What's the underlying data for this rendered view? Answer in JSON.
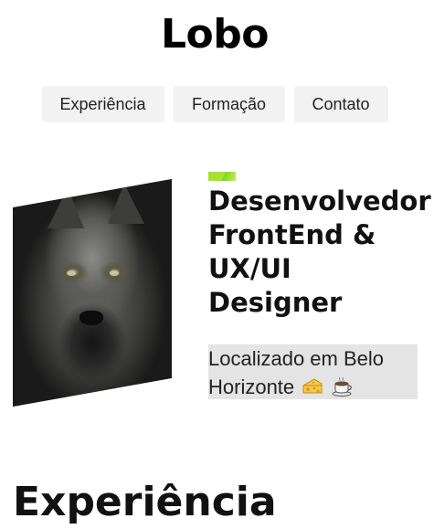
{
  "site": {
    "title": "Lobo"
  },
  "nav": {
    "items": [
      {
        "label": "Experiência"
      },
      {
        "label": "Formação"
      },
      {
        "label": "Contato"
      }
    ]
  },
  "hero": {
    "headline": "Desenvolvedor FrontEnd & UX/UI Designer",
    "location_text": "Localizado em Belo Horizonte",
    "location_icons": [
      "cheese-icon",
      "coffee-icon"
    ],
    "accent_color": "#a6e22e",
    "image_subject": "wolf"
  },
  "sections": {
    "experience_title": "Experiência"
  }
}
